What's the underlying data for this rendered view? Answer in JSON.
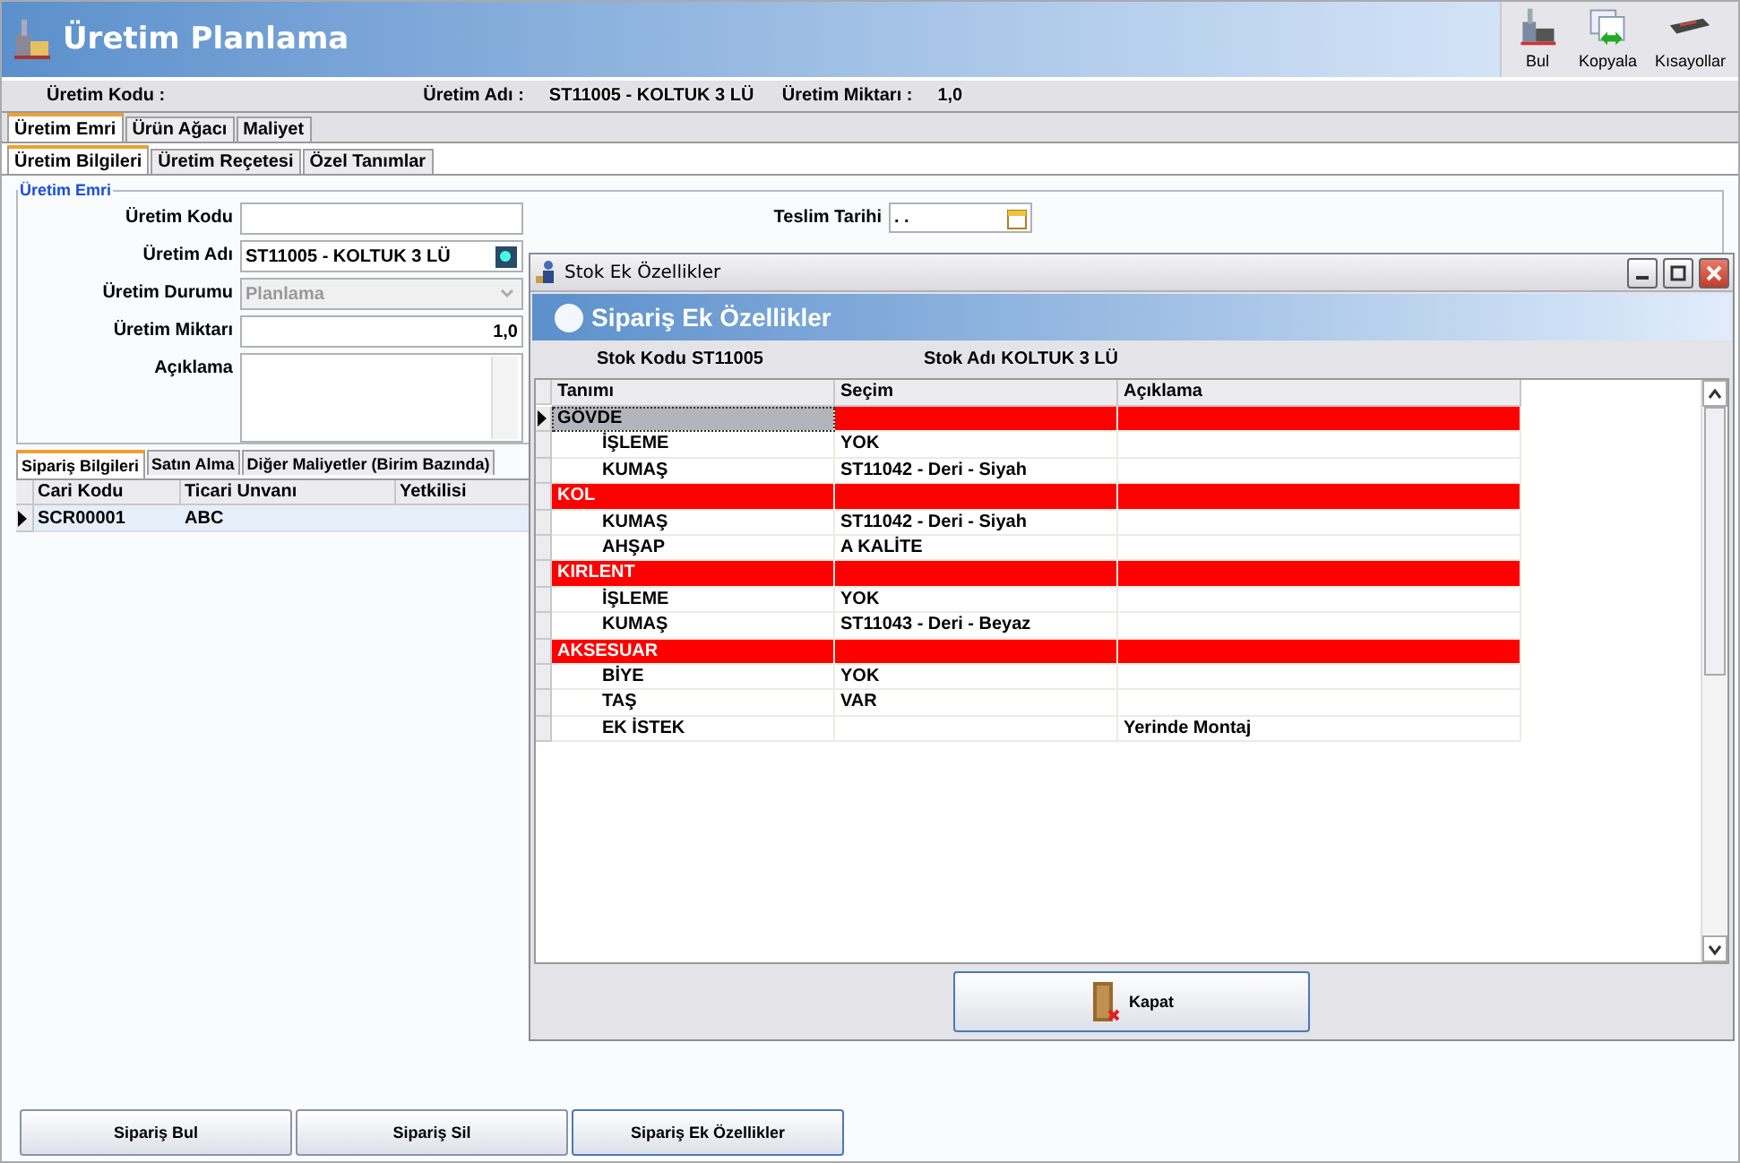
{
  "window": {
    "title": "Üretim Planlama"
  },
  "toolbar": [
    {
      "label": "Bul"
    },
    {
      "label": "Kopyala"
    },
    {
      "label": "Kısayollar"
    }
  ],
  "info_bar": [
    {
      "label": "Üretim Kodu  :"
    },
    {
      "label": "Üretim Adı  :",
      "value": "ST11005 - KOLTUK 3 LÜ"
    },
    {
      "label": "Üretim Miktarı  :",
      "value": "1,0"
    }
  ],
  "tabs": [
    {
      "label": "Üretim Emri",
      "selected": true
    },
    {
      "label": "Ürün Ağacı",
      "selected": false
    },
    {
      "label": "Maliyet",
      "selected": false
    }
  ],
  "sub_tabs": [
    {
      "label": "Üretim Bilgileri",
      "selected": true
    },
    {
      "label": "Üretim Reçetesi",
      "selected": false
    },
    {
      "label": "Özel Tanımlar",
      "selected": false
    }
  ],
  "group_title": "Üretim Emri",
  "form": [
    {
      "label": "Üretim Kodu",
      "kind": "text"
    },
    {
      "label": "Üretim Adı",
      "kind": "lookup",
      "value": "ST11005 - KOLTUK 3 LÜ"
    },
    {
      "label": "Üretim Durumu",
      "kind": "combo",
      "value": "Planlama",
      "disabled": true
    },
    {
      "label": "Üretim Miktarı",
      "kind": "number",
      "value": "1,0"
    },
    {
      "label": "Açıklama",
      "kind": "memo"
    }
  ],
  "date_fields": [
    {
      "label": "Teslim Tarihi",
      "value": ". ."
    }
  ],
  "order_tabs": [
    {
      "label": "Sipariş Bilgileri",
      "selected": true
    },
    {
      "label": "Satın Alma",
      "selected": false
    },
    {
      "label": "Diğer Maliyetler (Birim Bazında)",
      "selected": false
    }
  ],
  "order_table": {
    "columns": [
      "Cari Kodu",
      "Ticari Unvanı",
      "Yetkilisi"
    ],
    "rows": [
      {
        "cells": [
          "SCR00001",
          "ABC",
          ""
        ],
        "selected": true
      }
    ]
  },
  "buttons": [
    "Sipariş Bul",
    "Sipariş Sil",
    "Sipariş Ek Özellikler"
  ],
  "dialog": {
    "title": "Stok Ek Özellikler",
    "header": "Sipariş Ek Özellikler",
    "info": [
      {
        "label": "Stok Kodu",
        "value": "ST11005"
      },
      {
        "label": "Stok Adı",
        "value": "KOLTUK 3 LÜ"
      }
    ],
    "columns": [
      "Tanımı",
      "Seçim",
      "Açıklama"
    ],
    "rows": [
      {
        "kind": "group",
        "cells": [
          "GÖVDE",
          "",
          ""
        ],
        "selected": true
      },
      {
        "kind": "item",
        "cells": [
          "İŞLEME",
          "YOK",
          ""
        ],
        "selected": false
      },
      {
        "kind": "item",
        "cells": [
          "KUMAŞ",
          "ST11042 - Deri - Siyah",
          ""
        ],
        "selected": false
      },
      {
        "kind": "group",
        "cells": [
          "KOL",
          "",
          ""
        ],
        "selected": false
      },
      {
        "kind": "item",
        "cells": [
          "KUMAŞ",
          "ST11042 - Deri - Siyah",
          ""
        ],
        "selected": false
      },
      {
        "kind": "item",
        "cells": [
          "AHŞAP",
          "A KALİTE",
          ""
        ],
        "selected": false
      },
      {
        "kind": "group",
        "cells": [
          "KIRLENT",
          "",
          ""
        ],
        "selected": false
      },
      {
        "kind": "item",
        "cells": [
          "İŞLEME",
          "YOK",
          ""
        ],
        "selected": false
      },
      {
        "kind": "item",
        "cells": [
          "KUMAŞ",
          "ST11043 - Deri - Beyaz",
          ""
        ],
        "selected": false
      },
      {
        "kind": "group",
        "cells": [
          "AKSESUAR",
          "",
          ""
        ],
        "selected": false
      },
      {
        "kind": "item",
        "cells": [
          "BİYE",
          "YOK",
          ""
        ],
        "selected": false
      },
      {
        "kind": "item",
        "cells": [
          "TAŞ",
          "VAR",
          ""
        ],
        "selected": false
      },
      {
        "kind": "item",
        "cells": [
          "EK İSTEK",
          "",
          "Yerinde Montaj"
        ],
        "selected": false
      }
    ],
    "close_button": "Kapat"
  }
}
